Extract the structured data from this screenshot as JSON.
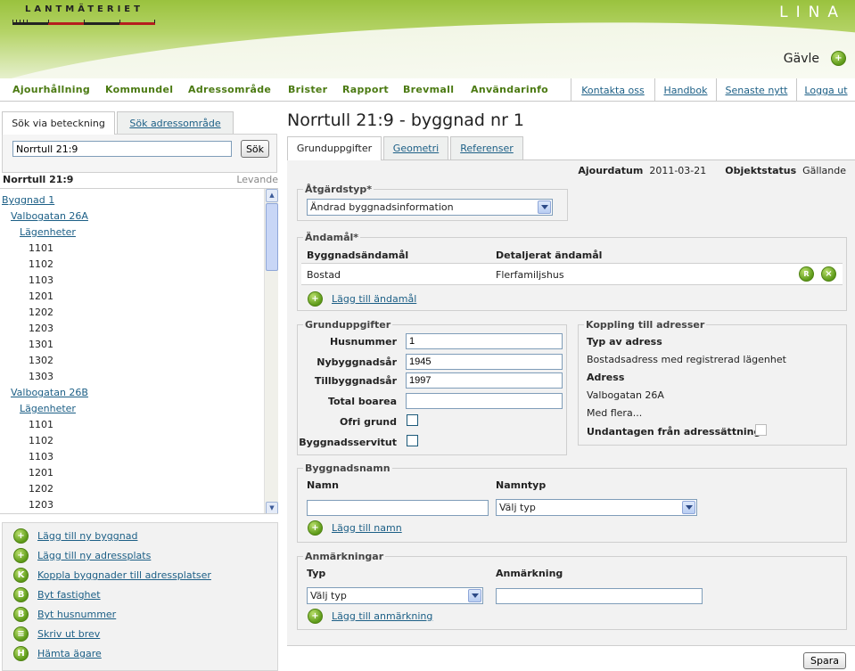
{
  "header": {
    "logo_text": "LANTMÄTERIET",
    "app_name": "LINA",
    "city": "Gävle"
  },
  "nav": {
    "items": [
      "Ajourhållning",
      "Kommundel",
      "Adressområde",
      "Brister",
      "Rapport",
      "Brevmall",
      "Användarinfo"
    ],
    "links": [
      "Kontakta oss",
      "Handbok",
      "Senaste nytt",
      "Logga ut"
    ]
  },
  "left": {
    "tabs": [
      "Sök via beteckning",
      "Sök adressområde"
    ],
    "search": {
      "value": "Norrtull 21:9",
      "button": "Sök"
    },
    "tree_title": "Norrtull 21:9",
    "tree_status": "Levande",
    "tree": [
      {
        "label": "Byggnad 1",
        "link": true
      },
      {
        "label": "Valbogatan 26A",
        "link": true
      },
      {
        "label": "Lägenheter",
        "link": true
      },
      {
        "label": "1101",
        "link": false
      },
      {
        "label": "1102",
        "link": false
      },
      {
        "label": "1103",
        "link": false
      },
      {
        "label": "1201",
        "link": false
      },
      {
        "label": "1202",
        "link": false
      },
      {
        "label": "1203",
        "link": false
      },
      {
        "label": "1301",
        "link": false
      },
      {
        "label": "1302",
        "link": false
      },
      {
        "label": "1303",
        "link": false
      },
      {
        "label": "Valbogatan 26B",
        "link": true
      },
      {
        "label": "Lägenheter",
        "link": true
      },
      {
        "label": "1101",
        "link": false
      },
      {
        "label": "1102",
        "link": false
      },
      {
        "label": "1103",
        "link": false
      },
      {
        "label": "1201",
        "link": false
      },
      {
        "label": "1202",
        "link": false
      },
      {
        "label": "1203",
        "link": false
      }
    ],
    "actions": [
      {
        "icon": "+",
        "label": "Lägg till ny byggnad"
      },
      {
        "icon": "+",
        "label": "Lägg till ny adressplats"
      },
      {
        "icon": "K",
        "label": "Koppla byggnader till adressplatser"
      },
      {
        "icon": "B",
        "label": "Byt fastighet"
      },
      {
        "icon": "B",
        "label": "Byt husnummer"
      },
      {
        "icon": "printer",
        "label": "Skriv ut brev"
      },
      {
        "icon": "H",
        "label": "Hämta ägare"
      }
    ]
  },
  "main": {
    "title": "Norrtull 21:9 - byggnad nr 1",
    "tabs": [
      "Grunduppgifter",
      "Geometri",
      "Referenser"
    ],
    "meta": {
      "ajourdatum_label": "Ajourdatum",
      "ajourdatum": "2011-03-21",
      "status_label": "Objektstatus",
      "status": "Gällande"
    },
    "atgardstyp": {
      "legend": "Åtgärdstyp*",
      "selected": "Ändrad byggnadsinformation"
    },
    "andamal": {
      "legend": "Ändamål*",
      "col1": "Byggnadsändamål",
      "col2": "Detaljerat ändamål",
      "row": {
        "col1": "Bostad",
        "col2": "Flerfamiljshus"
      },
      "add_label": "Lägg till ändamål"
    },
    "grunduppgifter": {
      "legend": "Grunduppgifter",
      "husnummer_label": "Husnummer",
      "husnummer": "1",
      "nybyggnadsar_label": "Nybyggnadsår",
      "nybyggnadsar": "1945",
      "tillbyggnadsar_label": "Tillbyggnadsår",
      "tillbyggnadsar": "1997",
      "total_boarea_label": "Total boarea",
      "total_boarea": "",
      "ofri_grund_label": "Ofri grund",
      "byggnadsservitut_label": "Byggnadsservitut"
    },
    "koppling": {
      "legend": "Koppling till adresser",
      "typ_label": "Typ av adress",
      "typ": "Bostadsadress med registrerad lägenhet",
      "adress_label": "Adress",
      "adress": "Valbogatan 26A",
      "more": "Med flera...",
      "undantagen_label": "Undantagen från adressättning"
    },
    "byggnadsnamn": {
      "legend": "Byggnadsnamn",
      "namn_label": "Namn",
      "namn": "",
      "namntyp_label": "Namntyp",
      "namntyp": "Välj typ",
      "add_label": "Lägg till namn"
    },
    "anmarkningar": {
      "legend": "Anmärkningar",
      "typ_label": "Typ",
      "typ": "Välj typ",
      "anm_label": "Anmärkning",
      "anm": "",
      "add_label": "Lägg till anmärkning"
    },
    "save_label": "Spara"
  }
}
